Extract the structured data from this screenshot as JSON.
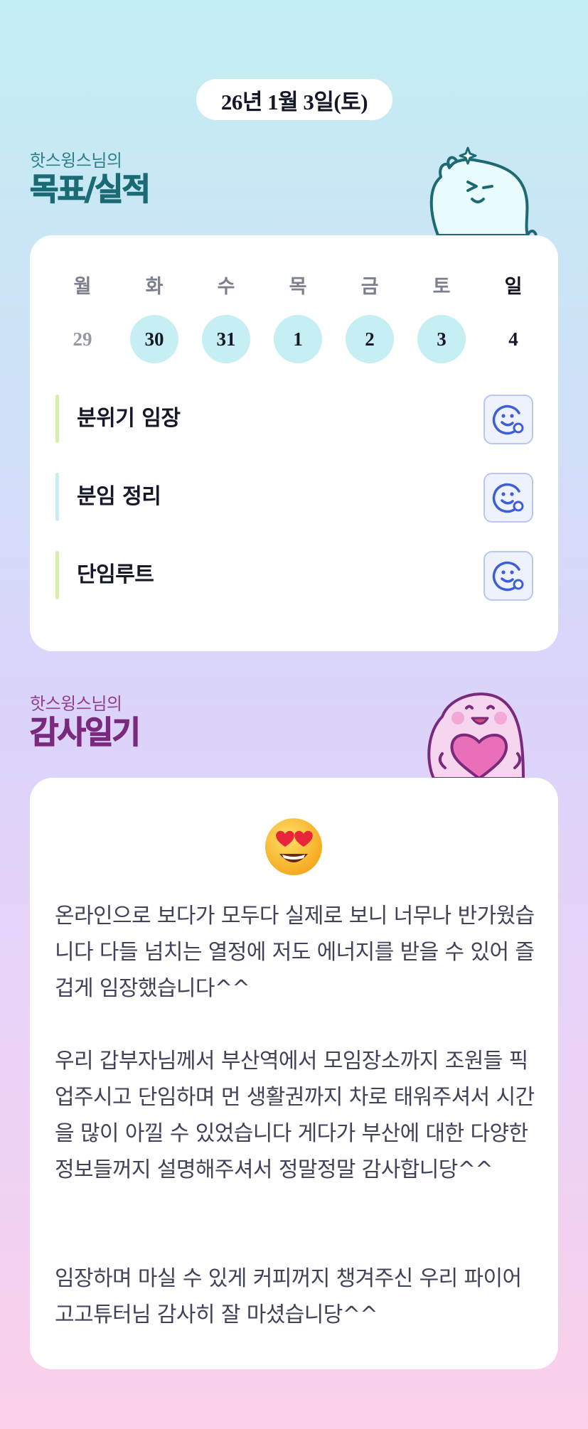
{
  "header": {
    "date": "26년 1월 3일(토)"
  },
  "goals_section": {
    "subtitle": "핫스윙스님의",
    "title": "목표/실적"
  },
  "week": {
    "days": [
      "월",
      "화",
      "수",
      "목",
      "금",
      "토",
      "일"
    ],
    "dates": [
      "29",
      "30",
      "31",
      "1",
      "2",
      "3",
      "4"
    ],
    "highlighted": [
      false,
      true,
      true,
      true,
      true,
      true,
      false
    ]
  },
  "goals": [
    {
      "label": "분위기 임장",
      "bar_color": "#d7efa9"
    },
    {
      "label": "분임 정리",
      "bar_color": "#c9ecf2"
    },
    {
      "label": "단임루트",
      "bar_color": "#d7efa9"
    }
  ],
  "thanks_section": {
    "subtitle": "핫스윙스님의",
    "title": "감사일기"
  },
  "diary": {
    "emoji": "heart-eyes-emoji",
    "paragraphs": [
      "온라인으로 보다가 모두다 실제로 보니 너무나 반가웠습니다 다들 넘치는 열정에 저도 에너지를 받을 수 있어 즐겁게 임장했습니다^^",
      "우리 갑부자님께서 부산역에서 모임장소까지 조원들 픽업주시고 단임하며 먼 생활권까지 차로 태워주셔서 시간을 많이 아낄 수 있었습니다 게다가 부산에 대한 다양한 정보들꺼지 설명해주셔서 정말정말 감사합니당^^",
      "임장하며 마실 수 있게 커피꺼지 챙겨주신 우리 파이어고고튜터님 감사히 잘 마셨습니당^^"
    ]
  },
  "colors": {
    "accent_teal": "#1b6b75",
    "accent_purple": "#7a2a7c",
    "active_date": "#c5eff2"
  }
}
